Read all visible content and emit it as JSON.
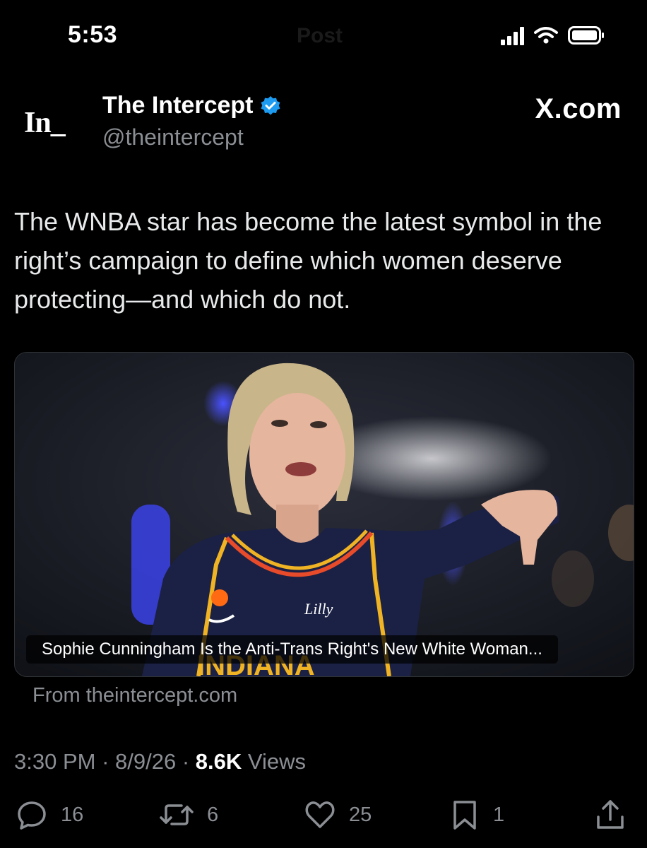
{
  "status_bar": {
    "time": "5:53",
    "ghost_title": "Post"
  },
  "tweet": {
    "author_name": "The Intercept",
    "handle": "@theintercept",
    "logo_text": "In_",
    "site_badge": "X.com",
    "text": "The WNBA star has become the latest symbol in the right’s campaign to define which women deserve protecting—and which do not.",
    "card": {
      "title": "Sophie Cunningham Is the Anti-Trans Right's New White Woman...",
      "source": "From theintercept.com",
      "jersey_text": "INDIANA",
      "jersey_sponsor": "Lilly"
    },
    "time": "3:30 PM",
    "date": "8/9/26",
    "views_count": "8.6K",
    "views_label": "Views"
  },
  "actions": {
    "replies": "16",
    "reposts": "6",
    "likes": "25",
    "bookmarks": "1"
  },
  "colors": {
    "background": "#000000",
    "text": "#e7e9ea",
    "muted": "#8b8f94",
    "verified": "#1d9bf0"
  }
}
